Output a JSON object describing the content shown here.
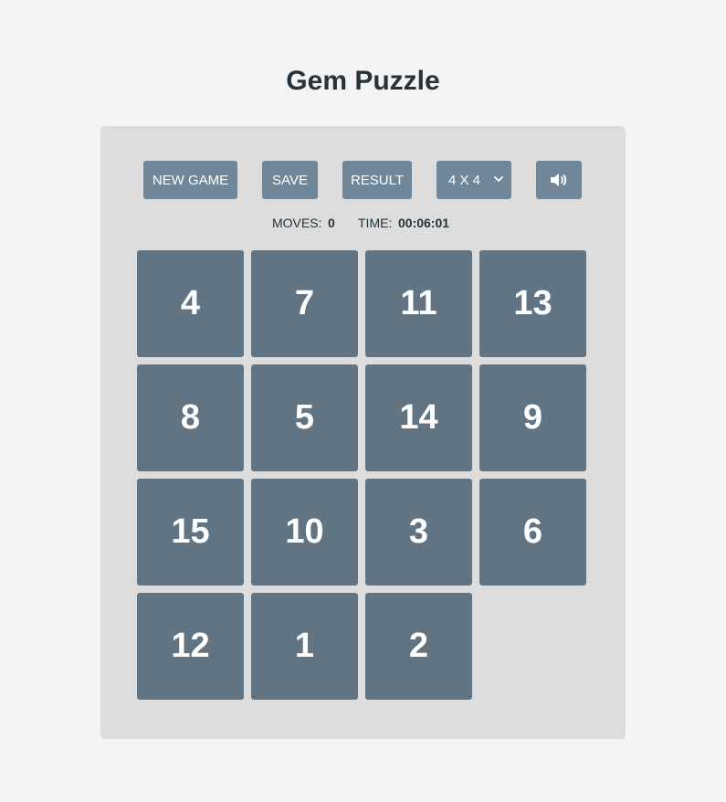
{
  "title": "Gem Puzzle",
  "toolbar": {
    "new_game_label": "NEW GAME",
    "save_label": "SAVE",
    "result_label": "RESULT",
    "size_selected": "4 X 4",
    "sound_icon": "speaker-icon"
  },
  "stats": {
    "moves_label": "MOVES:",
    "moves_value": "0",
    "time_label": "TIME:",
    "time_value": "00:06:01"
  },
  "grid": {
    "size": 4,
    "tiles": [
      4,
      7,
      11,
      13,
      8,
      5,
      14,
      9,
      15,
      10,
      3,
      6,
      12,
      1,
      2,
      null
    ]
  },
  "colors": {
    "background": "#f4f4f4",
    "board": "#dddddd",
    "button": "#708799",
    "tile": "#607484",
    "text": "#263238"
  }
}
